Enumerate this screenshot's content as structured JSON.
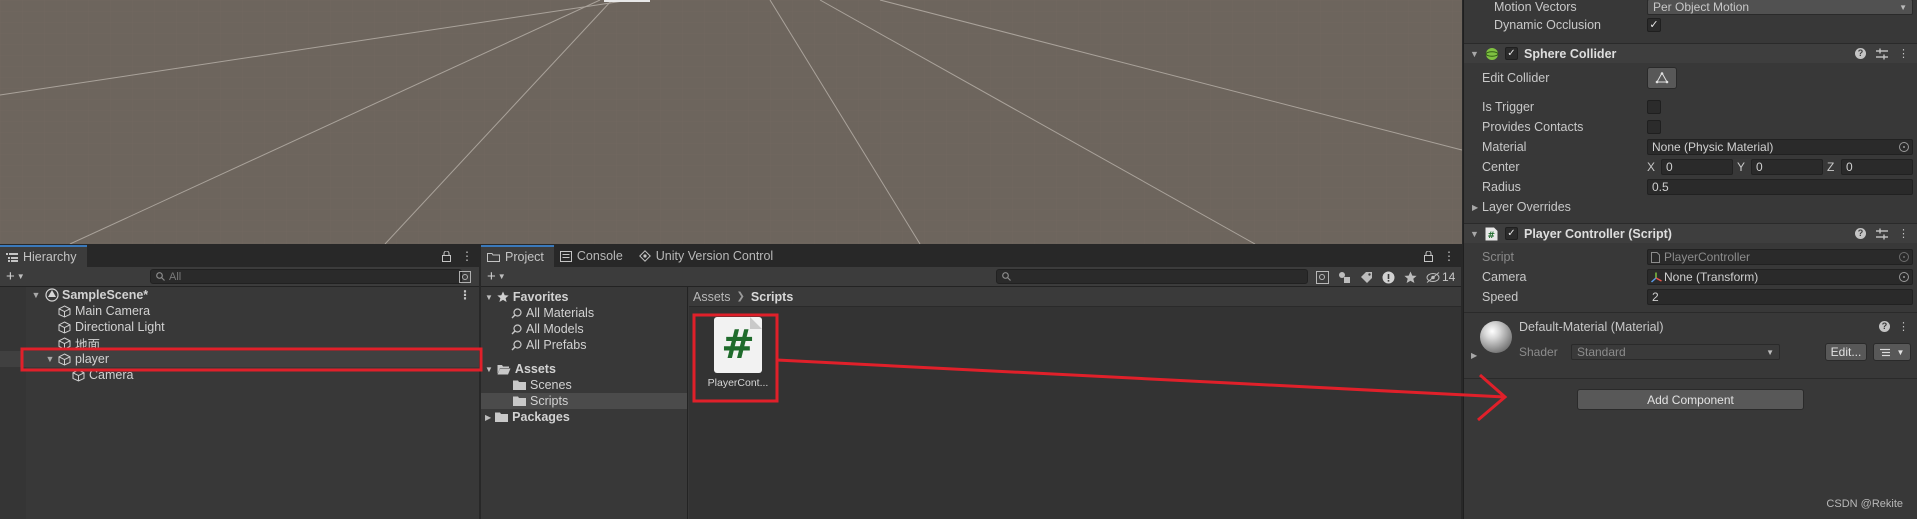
{
  "scene": {
    "background": "#6d655d"
  },
  "hierarchy": {
    "tab_label": "Hierarchy",
    "search_placeholder": "All",
    "items": [
      {
        "label": "SampleScene*",
        "icon": "unity-scene-icon"
      },
      {
        "label": "Main Camera",
        "icon": "gameobject-icon"
      },
      {
        "label": "Directional Light",
        "icon": "gameobject-icon"
      },
      {
        "label": "地面",
        "icon": "gameobject-icon"
      },
      {
        "label": "player",
        "icon": "gameobject-icon"
      },
      {
        "label": "Camera",
        "icon": "gameobject-icon"
      }
    ]
  },
  "project": {
    "tabs": [
      "Project",
      "Console",
      "Unity Version Control"
    ],
    "hidden_count": "14",
    "tree": {
      "favorites": "Favorites",
      "favorite_items": [
        "All Materials",
        "All Models",
        "All Prefabs"
      ],
      "assets": "Assets",
      "asset_folders": [
        "Scenes",
        "Scripts"
      ],
      "packages": "Packages"
    },
    "breadcrumb": [
      "Assets",
      "Scripts"
    ],
    "asset_item": {
      "icon_glyph": "#",
      "label": "PlayerCont..."
    }
  },
  "inspector": {
    "motion_vectors_label": "Motion Vectors",
    "motion_vectors_value": "Per Object Motion",
    "dynamic_occlusion_label": "Dynamic Occlusion",
    "sphere_collider": {
      "title": "Sphere Collider",
      "edit_collider": "Edit Collider",
      "is_trigger": "Is Trigger",
      "provides_contacts": "Provides Contacts",
      "material_label": "Material",
      "material_value": "None (Physic Material)",
      "center_label": "Center",
      "center": {
        "x": "0",
        "y": "0",
        "z": "0"
      },
      "axis_x": "X",
      "axis_y": "Y",
      "axis_z": "Z",
      "radius_label": "Radius",
      "radius_value": "0.5",
      "layer_overrides": "Layer Overrides"
    },
    "player_controller": {
      "title": "Player Controller (Script)",
      "script_label": "Script",
      "script_value": "PlayerController",
      "camera_label": "Camera",
      "camera_value": "None (Transform)",
      "speed_label": "Speed",
      "speed_value": "2"
    },
    "material": {
      "title": "Default-Material (Material)",
      "shader_label": "Shader",
      "shader_value": "Standard",
      "edit_button": "Edit..."
    },
    "add_component": "Add Component"
  },
  "watermark": "CSDN @Rekite",
  "colors": {
    "annotation_red": "#e0202a",
    "selection_blue": "#3a79bb"
  }
}
